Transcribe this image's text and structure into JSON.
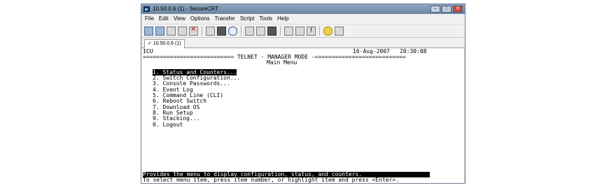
{
  "window": {
    "title": "10.50.0.6 (1) - SecureCRT",
    "controls": [
      "–",
      "□",
      "✕"
    ]
  },
  "menubar": {
    "items": [
      "File",
      "Edit",
      "View",
      "Options",
      "Transfer",
      "Script",
      "Tools",
      "Help"
    ]
  },
  "toolbar": {
    "icons": [
      "connect-icon",
      "quick-connect-icon",
      "connect-in-tab-icon",
      "reconnect-icon",
      "disconnect-icon",
      "copy-icon",
      "paste-icon",
      "find-icon",
      "print-setup-icon",
      "print-screen-icon",
      "print-icon",
      "session-options-icon",
      "global-options-icon",
      "keymap-icon",
      "help-icon",
      "about-icon"
    ]
  },
  "tabs": [
    {
      "label": "10.50.0.6 (1)",
      "active": true
    }
  ],
  "terminal": {
    "host": "ICU",
    "date": "16-Aug-2007",
    "time": "20:30:08",
    "banner": "=========================== TELNET - MANAGER MODE -===========================",
    "menu_title": "Main Menu",
    "menu_items": [
      "1. Status and Counters...",
      "2. Switch Configuration...",
      "3. Console Passwords...",
      "4. Event Log",
      "5. Command Line (CLI)",
      "6. Reboot Switch",
      "7. Download OS",
      "8. Run Setup",
      "9. Stacking...",
      "0. Logout"
    ],
    "selected_index": 0,
    "help_line": "Provides the menu to display configuration, status, and counters.",
    "hint_line": "To select menu item, press item number, or highlight item and press <Enter>."
  }
}
